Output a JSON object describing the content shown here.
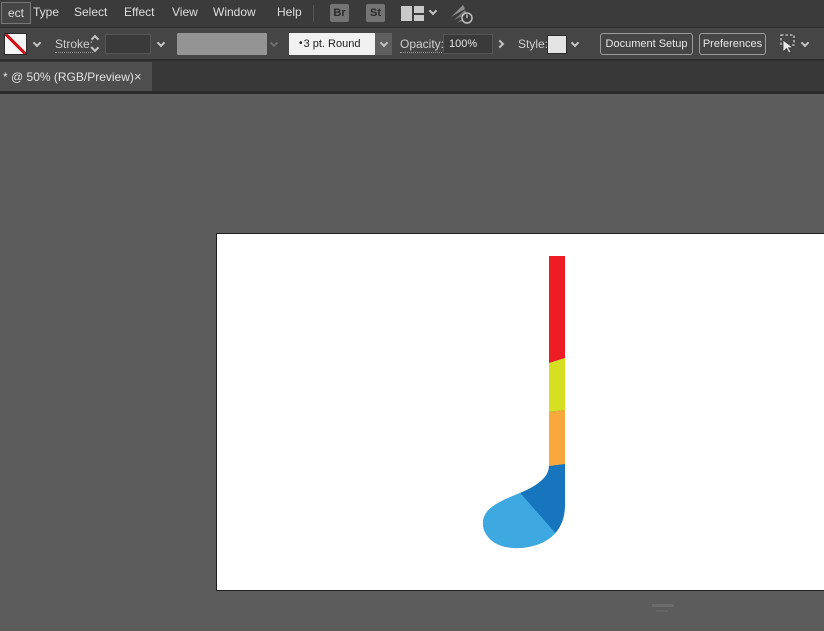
{
  "menu_bar": {
    "items": [
      {
        "label": "ect"
      },
      {
        "label": "Type"
      },
      {
        "label": "Select"
      },
      {
        "label": "Effect"
      },
      {
        "label": "View"
      },
      {
        "label": "Window"
      },
      {
        "label": "Help"
      }
    ],
    "bridge_badge": "Br",
    "stock_badge": "St"
  },
  "control_bar": {
    "stroke_label": "Stroke:",
    "brush_dot": "•",
    "brush": "3 pt. Round",
    "opacity_label": "Opacity:",
    "opacity_value": "100%",
    "style_label": "Style:",
    "document_setup": "Document Setup",
    "preferences": "Preferences"
  },
  "tab_bar": {
    "active_tab": "* @ 50% (RGB/Preview)",
    "close": "×"
  },
  "canvas": {
    "artwork_name": "hockey-stick",
    "colors": {
      "red": "#EE1C25",
      "yellow_green": "#D7DF23",
      "orange": "#F9A83C",
      "dark_blue": "#1675BC",
      "light_blue": "#3EA9E1"
    }
  }
}
